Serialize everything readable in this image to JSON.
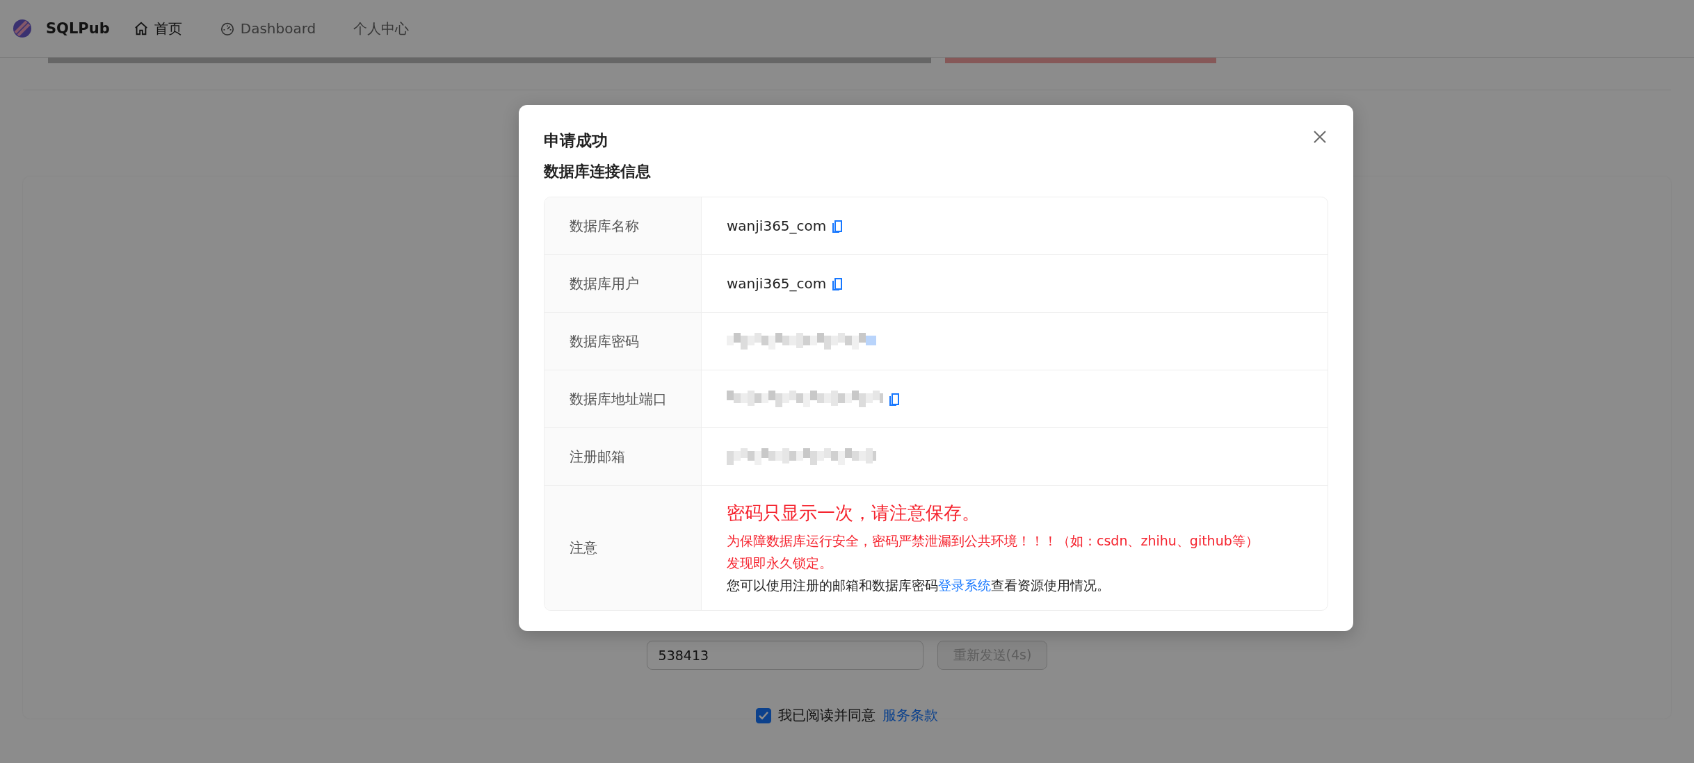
{
  "header": {
    "brand": "SQLPub",
    "nav": [
      {
        "label": "首页",
        "selected": true
      },
      {
        "label": "Dashboard",
        "selected": false
      },
      {
        "label": "个人中心",
        "selected": false
      }
    ]
  },
  "form": {
    "code_field": {
      "value": "538413"
    },
    "resend_button": {
      "label": "重新发送(4s)",
      "disabled": true
    },
    "agreement": {
      "checked": true,
      "text": "我已阅读并同意",
      "link": "服务条款"
    }
  },
  "modal": {
    "title": "申请成功",
    "subtitle": "数据库连接信息",
    "rows": [
      {
        "kind": "text",
        "label": "数据库名称",
        "value": "wanji365_com",
        "copy": true
      },
      {
        "kind": "text",
        "label": "数据库用户",
        "value": "wanji365_com",
        "copy": true
      },
      {
        "kind": "redacted",
        "label": "数据库密码",
        "copy": false
      },
      {
        "kind": "redacted",
        "label": "数据库地址端口",
        "copy": true
      },
      {
        "kind": "redacted",
        "label": "注册邮箱",
        "copy": false
      },
      {
        "kind": "note",
        "label": "注意",
        "lines": [
          {
            "kind": "warning-large",
            "text": "密码只显示一次，请注意保存。"
          },
          {
            "kind": "warning",
            "text": "为保障数据库运行安全，密码严禁泄漏到公共环境！！！（如：csdn、zhihu、github等）"
          },
          {
            "kind": "warning",
            "text": "发现即永久锁定。"
          },
          {
            "kind": "info",
            "before": "您可以使用注册的邮箱和数据库密码",
            "link": "登录系统",
            "after": "查看资源使用情况。"
          }
        ]
      }
    ]
  }
}
